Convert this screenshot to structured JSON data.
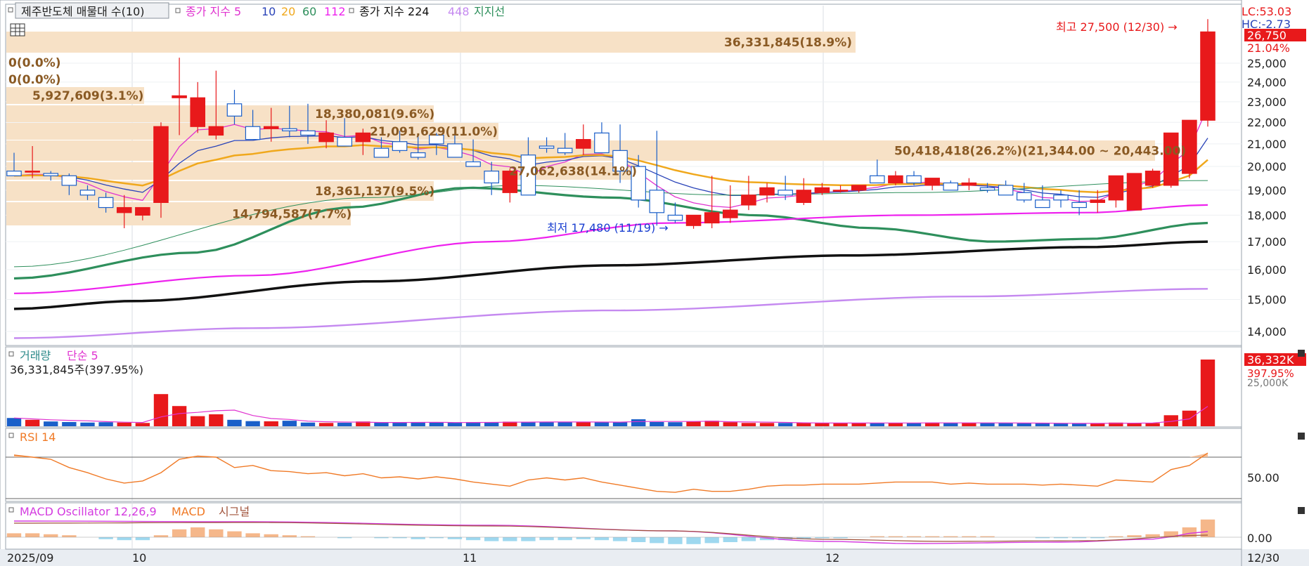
{
  "legend": {
    "title": "제주반도체 매물대 수(10)",
    "ma_label": "종가 지수 5",
    "ma10": "10",
    "ma20": "20",
    "ma60": "60",
    "ma112": "112",
    "ma224_label": "종가 지수 224",
    "ma448": "448",
    "support": "지지선"
  },
  "colors": {
    "up": "#e8191b",
    "down": "#1a5fc9",
    "ma5": "#e033d0",
    "ma10": "#2943b8",
    "ma20": "#f0a81c",
    "ma60": "#2e8f5c",
    "ma112": "#ee22ee",
    "ma224": "#111111",
    "ma448": "#c58af0",
    "volume_band": "#f7e1c6",
    "rsi": "#f07a26",
    "macd": "#d43be0",
    "macd_line": "#f07a26",
    "signal": "#a0523a",
    "grid": "#d8dde3"
  },
  "price_panel": {
    "right_top_labels": [
      "LC:53.03",
      "HC:-2.73"
    ],
    "current_price": "26,750",
    "current_change": "21.04%",
    "high_note": "최고 27,500 (12/30) →",
    "low_note": "최저 17,480 (11/19) →",
    "volume_profile": [
      {
        "label": "36,331,845(18.9%)"
      },
      {
        "label": "0(0.0%)"
      },
      {
        "label": "0(0.0%)"
      },
      {
        "label": "5,927,609(3.1%)"
      },
      {
        "label": "18,380,081(9.6%)"
      },
      {
        "label": "21,091,629(11.0%)"
      },
      {
        "label": "50,418,418(26.2%)(21,344.00 ~ 20,443.00)"
      },
      {
        "label": "27,062,638(14.1%)"
      },
      {
        "label": "18,361,137(9.5%)"
      },
      {
        "label": "14,794,587(7.7%)"
      }
    ],
    "y_ticks": [
      "25,000",
      "24,000",
      "23,000",
      "22,000",
      "21,000",
      "20,000",
      "19,000",
      "18,000",
      "17,000",
      "16,000",
      "15,000",
      "14,000"
    ]
  },
  "volume_panel": {
    "title": "거래량",
    "ma_label": "단순 5",
    "info": "36,331,845주(397.95%)",
    "right_value": "36,332K",
    "right_pct": "397.95%",
    "right_sub": "25,000K"
  },
  "rsi_panel": {
    "title": "RSI 14",
    "tick": "50.00"
  },
  "macd_panel": {
    "title": "MACD Oscillator 12,26,9",
    "macd_label": "MACD",
    "signal_label": "시그널",
    "tick": "0.00"
  },
  "x_axis": {
    "labels": [
      "2025/09",
      "10",
      "11",
      "12"
    ],
    "right_label": "12/30"
  },
  "chart_data": {
    "type": "candlestick",
    "dates": [
      "09/22",
      "09/23",
      "09/24",
      "09/25",
      "09/26",
      "09/29",
      "09/30",
      "10/01",
      "10/02",
      "10/10",
      "10/13",
      "10/14",
      "10/15",
      "10/16",
      "10/17",
      "10/20",
      "10/21",
      "10/22",
      "10/23",
      "10/24",
      "10/27",
      "10/28",
      "10/29",
      "10/30",
      "10/31",
      "11/03",
      "11/04",
      "11/05",
      "11/06",
      "11/07",
      "11/10",
      "11/11",
      "11/12",
      "11/13",
      "11/14",
      "11/17",
      "11/18",
      "11/19",
      "11/20",
      "11/21",
      "11/24",
      "11/25",
      "11/26",
      "11/27",
      "11/28",
      "12/01",
      "12/02",
      "12/03",
      "12/04",
      "12/05",
      "12/08",
      "12/09",
      "12/10",
      "12/11",
      "12/12",
      "12/15",
      "12/16",
      "12/17",
      "12/18",
      "12/19",
      "12/22",
      "12/23",
      "12/24",
      "12/26",
      "12/29",
      "12/30"
    ],
    "open": [
      19800,
      19800,
      19700,
      19600,
      19000,
      18700,
      18100,
      18000,
      18500,
      23200,
      21800,
      21400,
      22900,
      21800,
      21700,
      21700,
      21600,
      21100,
      21300,
      21100,
      20800,
      21100,
      20600,
      21400,
      21000,
      20200,
      19800,
      18900,
      20500,
      20900,
      20800,
      20800,
      21500,
      20700,
      20000,
      19000,
      18000,
      17600,
      17700,
      17900,
      18400,
      18800,
      19000,
      18500,
      18900,
      19000,
      19000,
      19600,
      19300,
      19600,
      19200,
      19300,
      19200,
      19100,
      19200,
      18900,
      18600,
      18800,
      18500,
      18500,
      18600,
      18200,
      19200,
      19200,
      19700,
      22100
    ],
    "high": [
      20600,
      20900,
      19800,
      19700,
      19200,
      18900,
      18800,
      18300,
      22000,
      25300,
      24000,
      24600,
      23600,
      22600,
      22700,
      22800,
      22900,
      22100,
      22200,
      21700,
      21300,
      21600,
      21400,
      21500,
      21800,
      21200,
      20200,
      19900,
      21300,
      21300,
      21500,
      21900,
      22000,
      21900,
      20500,
      21600,
      18500,
      17900,
      19600,
      19200,
      19600,
      19300,
      19600,
      19500,
      19300,
      19200,
      19200,
      20300,
      19800,
      19800,
      19500,
      19400,
      19500,
      19300,
      19400,
      19300,
      19200,
      19000,
      19000,
      19000,
      19100,
      19600,
      19900,
      20000,
      21800,
      27500
    ],
    "low": [
      19600,
      19500,
      19400,
      18800,
      18600,
      18100,
      17500,
      17800,
      17900,
      21400,
      21500,
      21200,
      21900,
      21300,
      21100,
      21300,
      21000,
      20800,
      20900,
      20500,
      20400,
      20600,
      20300,
      20500,
      20500,
      20000,
      18800,
      18500,
      18800,
      20600,
      20500,
      20500,
      20600,
      19300,
      18300,
      17600,
      17700,
      17480,
      17500,
      17700,
      18200,
      18500,
      18600,
      18400,
      18800,
      18900,
      18900,
      19400,
      19200,
      19200,
      19000,
      19000,
      19000,
      18900,
      18800,
      18500,
      18300,
      18300,
      18000,
      18100,
      18300,
      18200,
      19100,
      19100,
      19500,
      21800
    ],
    "close": [
      19600,
      19800,
      19600,
      19200,
      18800,
      18300,
      18300,
      18300,
      21800,
      23300,
      23200,
      21800,
      22300,
      21200,
      21800,
      21600,
      21400,
      21500,
      20900,
      21500,
      20400,
      20700,
      20400,
      21000,
      20400,
      20000,
      19300,
      19800,
      18800,
      20800,
      20600,
      21200,
      20600,
      19800,
      18600,
      18100,
      17800,
      18000,
      18100,
      18200,
      18800,
      19100,
      18800,
      19000,
      19100,
      19000,
      19200,
      19300,
      19600,
      19300,
      19500,
      19000,
      19300,
      19000,
      18800,
      18600,
      18300,
      18600,
      18300,
      18600,
      19600,
      19700,
      19800,
      21500,
      22100,
      26750
    ],
    "volume_profile": [
      {
        "volume": 36331845,
        "pct": 18.9
      },
      {
        "volume": 0,
        "pct": 0.0
      },
      {
        "volume": 0,
        "pct": 0.0
      },
      {
        "volume": 5927609,
        "pct": 3.1
      },
      {
        "volume": 18380081,
        "pct": 9.6
      },
      {
        "volume": 21091629,
        "pct": 11.0
      },
      {
        "volume": 50418418,
        "pct": 26.2,
        "range": [
          21344.0,
          20443.0
        ]
      },
      {
        "volume": 27062638,
        "pct": 14.1
      },
      {
        "volume": 18361137,
        "pct": 9.5
      },
      {
        "volume": 14794587,
        "pct": 7.7
      }
    ],
    "volume": [
      4.5,
      3.5,
      2.6,
      2.3,
      2.0,
      2.2,
      2.0,
      1.8,
      17.5,
      11.0,
      5.5,
      6.5,
      3.5,
      2.8,
      2.7,
      3.0,
      2.0,
      1.8,
      1.9,
      2.6,
      2.0,
      2.0,
      2.0,
      2.2,
      1.9,
      2.3,
      2.2,
      2.5,
      2.4,
      2.3,
      2.2,
      2.2,
      2.4,
      2.2,
      3.8,
      2.3,
      2.2,
      2.5,
      3.0,
      2.2,
      1.8,
      1.8,
      1.8,
      1.8,
      1.7,
      1.7,
      1.8,
      1.9,
      1.8,
      1.7,
      2.0,
      1.8,
      1.8,
      1.9,
      1.7,
      1.6,
      1.6,
      1.5,
      1.5,
      1.7,
      2.0,
      1.8,
      1.7,
      6.0,
      8.5,
      36.3
    ],
    "rsi": [
      72,
      70,
      68,
      60,
      55,
      49,
      45,
      47,
      55,
      68,
      71,
      70,
      60,
      62,
      57,
      56,
      54,
      55,
      52,
      54,
      50,
      51,
      49,
      51,
      49,
      46,
      44,
      42,
      48,
      50,
      48,
      50,
      46,
      43,
      40,
      37,
      36,
      39,
      37,
      37,
      39,
      42,
      43,
      43,
      44,
      44,
      44,
      45,
      46,
      46,
      46,
      44,
      45,
      44,
      44,
      44,
      43,
      44,
      43,
      42,
      48,
      47,
      46,
      58,
      62,
      74
    ],
    "macd_osc": [
      0.4,
      0.4,
      0.3,
      0.2,
      0.0,
      -0.2,
      -0.3,
      -0.3,
      0.2,
      0.8,
      1.0,
      0.8,
      0.6,
      0.4,
      0.3,
      0.2,
      0.1,
      0.0,
      -0.1,
      0.0,
      -0.1,
      -0.1,
      -0.2,
      -0.1,
      -0.2,
      -0.3,
      -0.4,
      -0.4,
      -0.4,
      -0.3,
      -0.3,
      -0.2,
      -0.3,
      -0.4,
      -0.5,
      -0.6,
      -0.7,
      -0.7,
      -0.6,
      -0.5,
      -0.4,
      -0.3,
      -0.3,
      -0.2,
      -0.1,
      -0.1,
      0.0,
      0.1,
      0.1,
      0.1,
      0.1,
      0.1,
      0.1,
      0.1,
      0.0,
      0.0,
      -0.1,
      -0.1,
      -0.1,
      -0.1,
      0.1,
      0.2,
      0.3,
      0.6,
      1.0,
      1.8
    ],
    "ylim": [
      13600,
      25800
    ]
  }
}
